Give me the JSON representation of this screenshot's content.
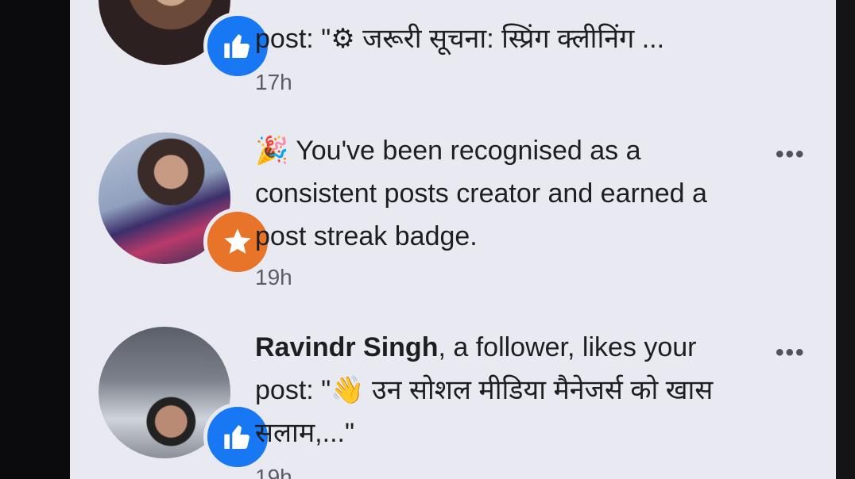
{
  "notifications": [
    {
      "text_bold": "",
      "text": "post: \"⚙ जरूरी सूचना: स्प्रिंग क्लीनिंग ...",
      "time": "17h",
      "badge": "like-icon"
    },
    {
      "emoji": "🎉",
      "text": "You've been recognised as a consistent posts creator and earned a post streak badge.",
      "time": "19h",
      "badge": "star-icon",
      "more": "•••"
    },
    {
      "name": "Ravindr Singh",
      "text": ", a follower, likes your post: \"👋 उन सोशल मीडिया मैनेजर्स को खास सलाम,...\"",
      "time": "19h",
      "badge": "like-icon",
      "more": "•••"
    }
  ],
  "colors": {
    "like": "#1877f2",
    "star": "#e8742a",
    "background": "#e9eaf1"
  }
}
